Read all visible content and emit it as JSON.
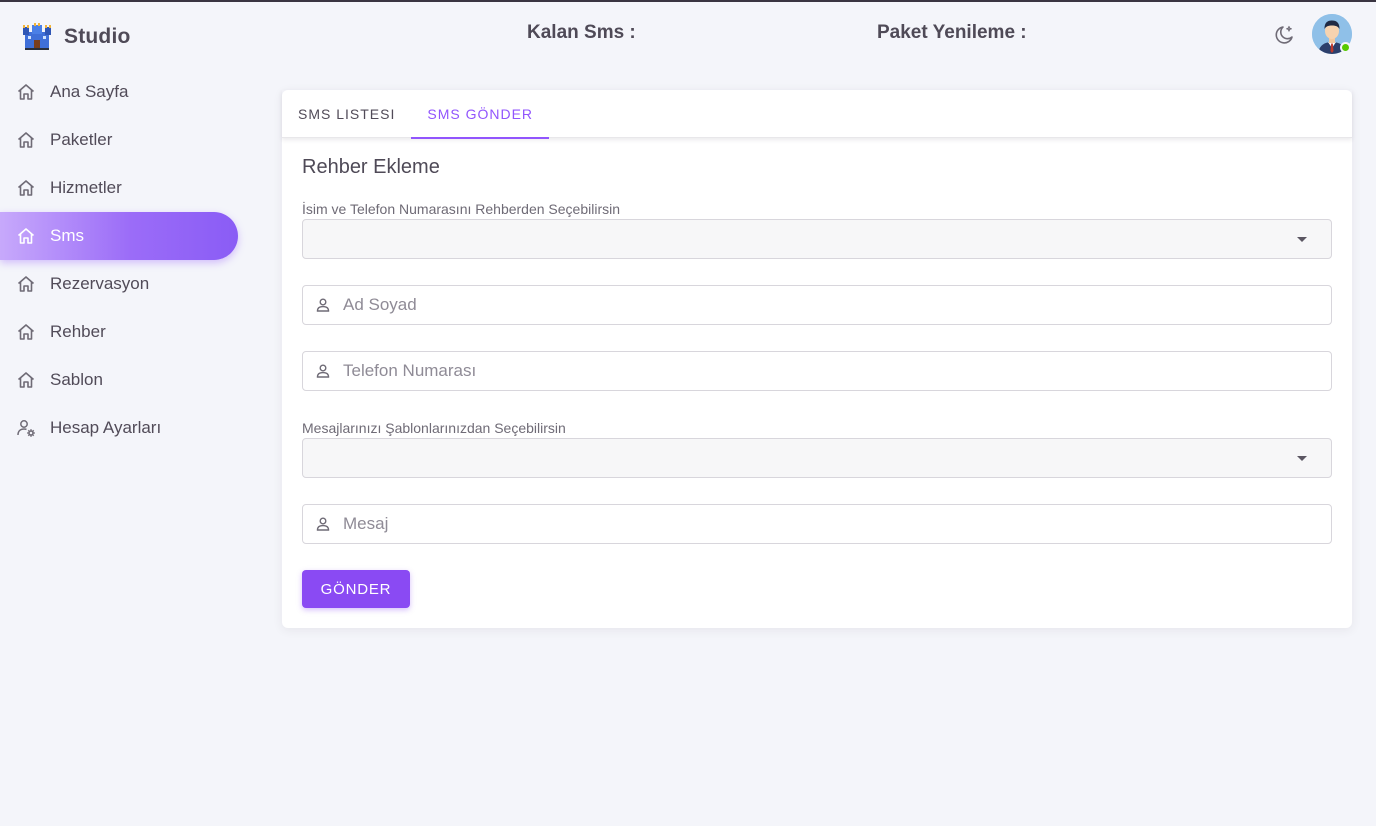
{
  "brand": {
    "name": "Studio",
    "logo_icon": "castle-logo-icon"
  },
  "sidebar": {
    "items": [
      {
        "label": "Ana Sayfa",
        "icon": "home-icon",
        "active": false
      },
      {
        "label": "Paketler",
        "icon": "home-icon",
        "active": false
      },
      {
        "label": "Hizmetler",
        "icon": "home-icon",
        "active": false
      },
      {
        "label": "Sms",
        "icon": "home-icon",
        "active": true
      },
      {
        "label": "Rezervasyon",
        "icon": "home-icon",
        "active": false
      },
      {
        "label": "Rehber",
        "icon": "home-icon",
        "active": false
      },
      {
        "label": "Sablon",
        "icon": "home-icon",
        "active": false
      },
      {
        "label": "Hesap Ayarları",
        "icon": "user-settings-icon",
        "active": false
      }
    ]
  },
  "header": {
    "kalan_sms": "Kalan Sms :",
    "paket_yenileme": "Paket Yenileme :",
    "theme_icon": "moon-star-icon",
    "avatar_icon": "user-avatar-icon",
    "status_color": "#56ca00"
  },
  "tabs": [
    {
      "label": "SMS LISTESI",
      "active": false
    },
    {
      "label": "SMS GÖNDER",
      "active": true
    }
  ],
  "form": {
    "title": "Rehber Ekleme",
    "contact_select_label": "İsim ve Telefon Numarasını Rehberden Seçebilirsin",
    "contact_select_value": "",
    "name_placeholder": "Ad Soyad",
    "name_value": "",
    "phone_placeholder": "Telefon Numarası",
    "phone_value": "",
    "template_select_label": "Mesajlarınızı Şablonlarınızdan Seçebilirsin",
    "template_select_value": "",
    "message_placeholder": "Mesaj",
    "message_value": "",
    "send_label": "GÖNDER"
  },
  "colors": {
    "primary": "#9155fd",
    "background": "#f4f5fa",
    "button": "#8a4af3"
  }
}
